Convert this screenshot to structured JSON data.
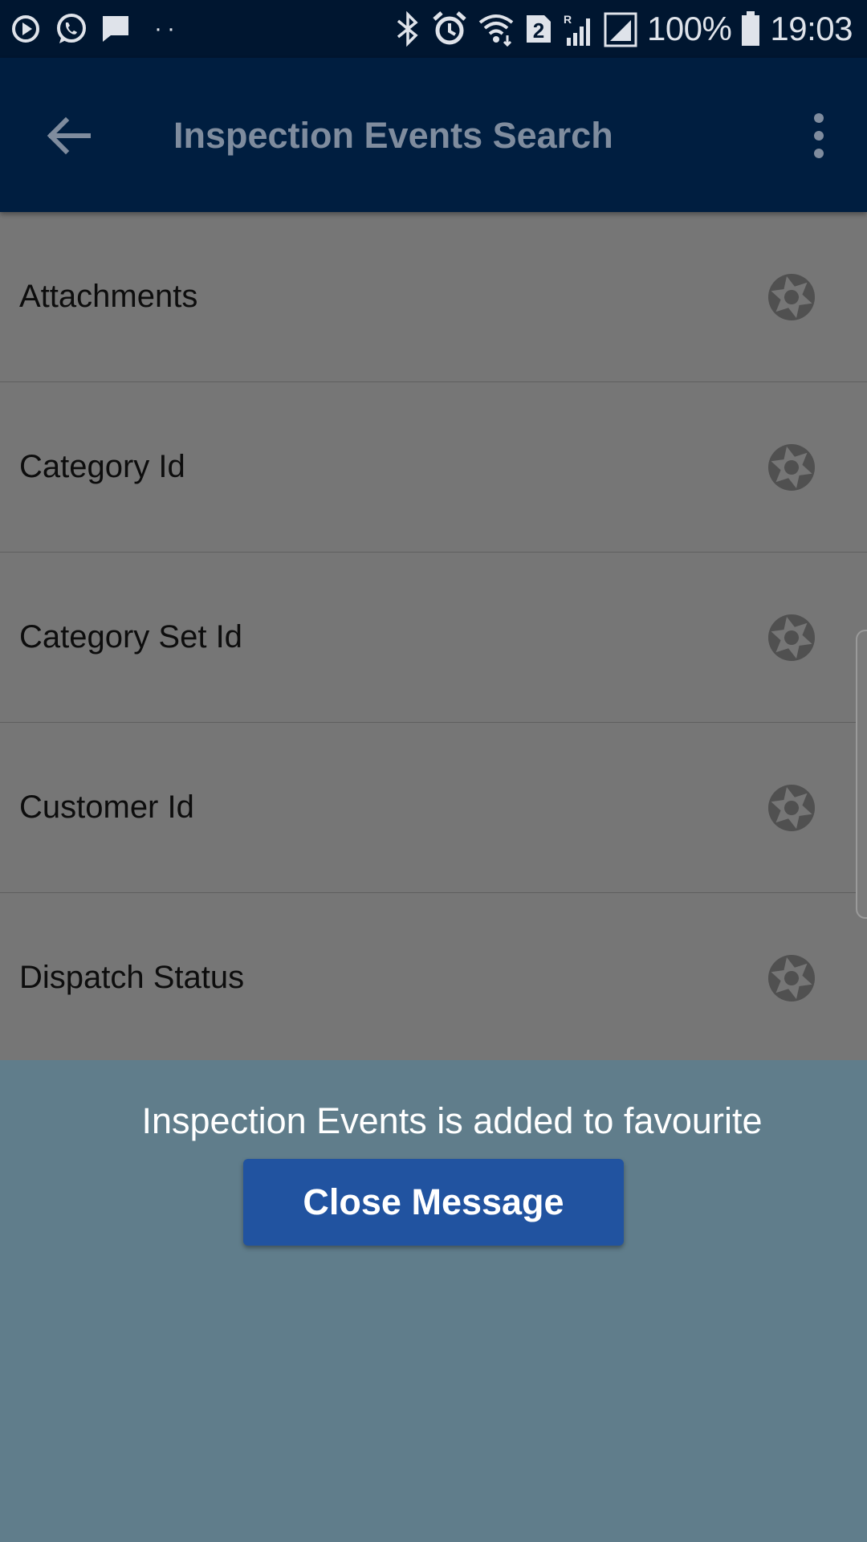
{
  "status_bar": {
    "battery_percent": "100%",
    "time": "19:03",
    "sim_badge": "2",
    "roaming_label": "R",
    "notification_dots": "··",
    "icons": [
      "media-play-icon",
      "whatsapp-icon",
      "message-icon",
      "bluetooth-icon",
      "alarm-icon",
      "wifi-icon",
      "sim-icon",
      "signal-icon",
      "battery-icon"
    ]
  },
  "app_bar": {
    "title": "Inspection Events Search",
    "back_icon": "arrow-left-icon",
    "menu_icon": "more-vert-icon"
  },
  "list": {
    "items": [
      {
        "label": "Attachments",
        "icon": "aperture-icon"
      },
      {
        "label": "Category Id",
        "icon": "aperture-icon"
      },
      {
        "label": "Category Set Id",
        "icon": "aperture-icon"
      },
      {
        "label": "Customer Id",
        "icon": "aperture-icon"
      },
      {
        "label": "Dispatch Status",
        "icon": "aperture-icon"
      }
    ]
  },
  "message": {
    "text": "Inspection Events is added to favourite",
    "close_label": "Close Message"
  },
  "colors": {
    "status_bar_bg": "#001630",
    "app_bar_bg": "#001e40",
    "app_title": "#7f8c9e",
    "list_bg": "#767676",
    "message_bg": "#607d8b",
    "button_bg": "#2153a0"
  }
}
